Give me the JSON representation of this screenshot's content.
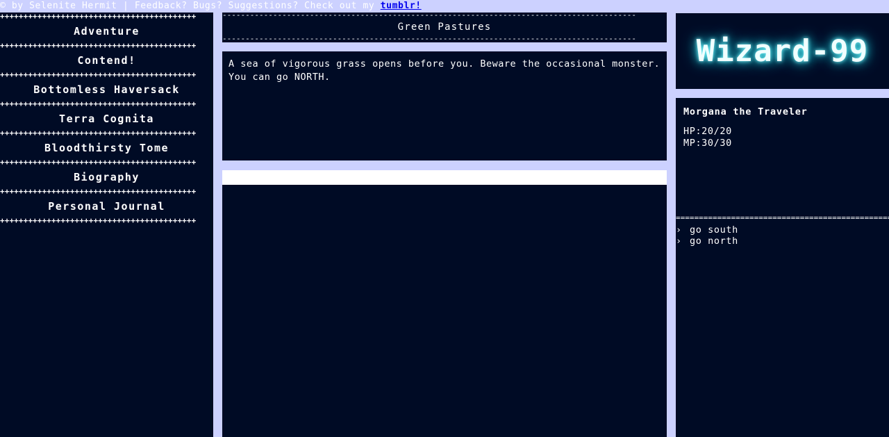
{
  "topbar": {
    "credit": "© by Selenite Hermit | Feedback? Bugs? Suggestions? Check out my ",
    "link_label": "tumblr!"
  },
  "nav": {
    "separator": "++++++++++++++++++++++++++++++++++++++++++",
    "items": [
      {
        "label": "Adventure"
      },
      {
        "label": "Contend!"
      },
      {
        "label": "Bottomless Haversack"
      },
      {
        "label": "Terra Cognita"
      },
      {
        "label": "Bloodthirsty Tome"
      },
      {
        "label": "Biography"
      },
      {
        "label": "Personal Journal"
      }
    ]
  },
  "location": {
    "dashes": "------------------------------------------------------------------------------------------",
    "title": "Green Pastures"
  },
  "description": {
    "line1": "A sea of vigorous grass opens before you. Beware the occasional monster.",
    "line2": "You can go NORTH."
  },
  "command_input": {
    "value": ""
  },
  "logo": {
    "text": "Wizard-99"
  },
  "character": {
    "name": "Morgana the Traveler",
    "hp": "HP:20/20",
    "mp": "MP:30/30",
    "separator": "==================================================",
    "caret": "›",
    "history": [
      {
        "text": "go south"
      },
      {
        "text": "go north"
      }
    ]
  },
  "colors": {
    "background": "#ccd1ff",
    "panel": "#000b25",
    "text": "#ffffff",
    "link": "#0000ee",
    "logo_glow": "#27d9e6"
  }
}
